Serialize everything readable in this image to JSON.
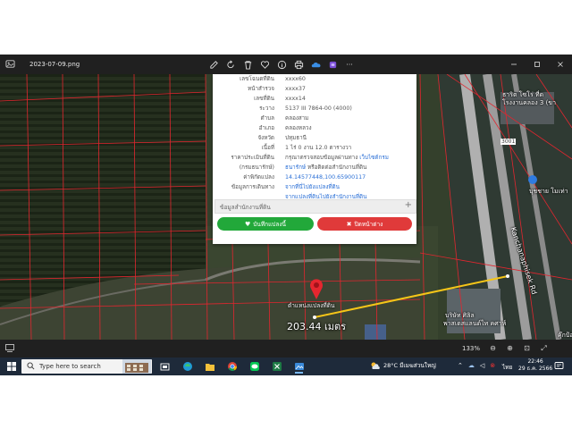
{
  "window": {
    "filename": "2023-07-09.png",
    "controls": [
      "minimize",
      "maximize",
      "close"
    ],
    "toolbar_icons": [
      "edit-icon",
      "rotate-icon",
      "delete-icon",
      "favorite-icon",
      "info-icon",
      "print-icon",
      "onedrive-icon",
      "clipchamp-icon",
      "more-icon"
    ],
    "toolbar_more": "···"
  },
  "popup": {
    "rows": [
      {
        "label": "เลขโฉนดที่ดิน",
        "value": "xxxx60"
      },
      {
        "label": "หน้าสำรวจ",
        "value": "xxxx37"
      },
      {
        "label": "เลขที่ดิน",
        "value": "xxxx14"
      },
      {
        "label": "ระวาง",
        "value": "5137 III 7864-00 (4000)"
      },
      {
        "label": "ตำบล",
        "value": "คลองสาม"
      },
      {
        "label": "อำเภอ",
        "value": "คลองหลวง"
      },
      {
        "label": "จังหวัด",
        "value": "ปทุมธานี"
      },
      {
        "label": "เนื้อที่",
        "value": "1 ไร่ 0 งาน 12.0 ตารางวา"
      },
      {
        "label": "ราคาประเมินที่ดิน",
        "value": "กรุณาตรวจสอบข้อมูลผ่านทาง",
        "value_link": "เว็บไซต์กรม"
      },
      {
        "label": "(กรมธนารักษ์)",
        "value_link_prefix": "ธนารักษ์",
        "value": " หรือติดต่อสำนักงานที่ดิน"
      },
      {
        "label": "ค่าพิกัดแปลง",
        "value_link": "14.14577448,100.65900117"
      },
      {
        "label": "ข้อมูลการเดินทาง",
        "value_link": "จากที่นี่ไปยังแปลงที่ดิน"
      },
      {
        "label": "",
        "value_link": "จากแปลงที่ดินไปยังสำนักงานที่ดิน"
      }
    ],
    "accordion_label": "ข้อมูลสำนักงานที่ดิน",
    "accordion_toggle": "+",
    "save_button": "บันทึกแปลงนี้",
    "close_button": "ปิดหน้าต่าง",
    "colors": {
      "save": "#22a83a",
      "close": "#e03a3a",
      "link": "#2a6fd6"
    }
  },
  "map": {
    "pin_label": "ตำแหน่งแปลงที่ดิน",
    "distance": "203.44 เมตร",
    "labels": {
      "poi_top": "ธาริต โซโร่ ที่ด",
      "poi_top2": "โรงงานคลอง 3 (ขา",
      "road_shield": "3001",
      "market": "บุชชาย โมเท่า",
      "road_name": "Kanchanaphisek Rd",
      "poi_bottom1": "บริษัท ศิลิล",
      "poi_bottom2": "พาสเดสแลนด์ไท คศาห์",
      "poi_bottom3": "คุ๊กป้อ"
    }
  },
  "status": {
    "zoom": "133%",
    "icons": [
      "zoom-out-icon",
      "zoom-in-icon",
      "fit-icon",
      "fullscreen-icon"
    ]
  },
  "taskbar": {
    "search_placeholder": "Type here to search",
    "apps": [
      "task-view-icon",
      "edge-icon",
      "file-explorer-icon",
      "chrome-icon",
      "line-icon",
      "excel-icon",
      "photos-icon"
    ],
    "weather": "28°C มีเมฆส่วนใหญ่",
    "language": "ไทย",
    "time": "22:46",
    "date": "29 ธ.ค. 2566"
  }
}
